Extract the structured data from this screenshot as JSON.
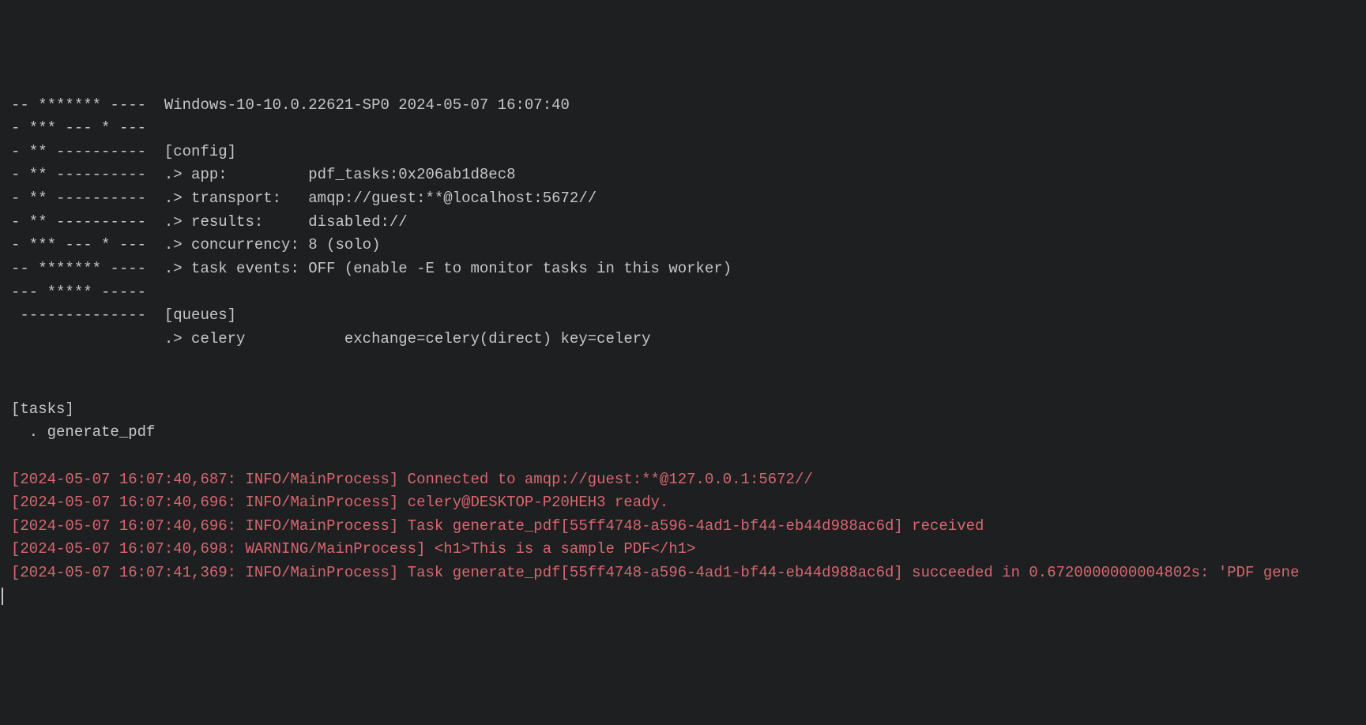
{
  "banner": {
    "line1": "-- ******* ----  Windows-10-10.0.22621-SP0 2024-05-07 16:07:40",
    "line2": "- *** --- * ---",
    "line3": "- ** ----------  [config]",
    "line4": "- ** ----------  .> app:         pdf_tasks:0x206ab1d8ec8",
    "line5": "- ** ----------  .> transport:   amqp://guest:**@localhost:5672//",
    "line6": "- ** ----------  .> results:     disabled://",
    "line7": "- *** --- * ---  .> concurrency: 8 (solo)",
    "line8": "-- ******* ----  .> task events: OFF (enable -E to monitor tasks in this worker)",
    "line9": "--- ***** -----",
    "line10": " --------------  [queues]",
    "line11": "                 .> celery           exchange=celery(direct) key=celery"
  },
  "tasks": {
    "header": "[tasks]",
    "item1": "  . generate_pdf"
  },
  "logs": {
    "line1": "[2024-05-07 16:07:40,687: INFO/MainProcess] Connected to amqp://guest:**@127.0.0.1:5672//",
    "line2": "[2024-05-07 16:07:40,696: INFO/MainProcess] celery@DESKTOP-P20HEH3 ready.",
    "line3": "[2024-05-07 16:07:40,696: INFO/MainProcess] Task generate_pdf[55ff4748-a596-4ad1-bf44-eb44d988ac6d] received",
    "line4": "[2024-05-07 16:07:40,698: WARNING/MainProcess] <h1>This is a sample PDF</h1>",
    "line5": "[2024-05-07 16:07:41,369: INFO/MainProcess] Task generate_pdf[55ff4748-a596-4ad1-bf44-eb44d988ac6d] succeeded in 0.6720000000004802s: 'PDF gene"
  }
}
